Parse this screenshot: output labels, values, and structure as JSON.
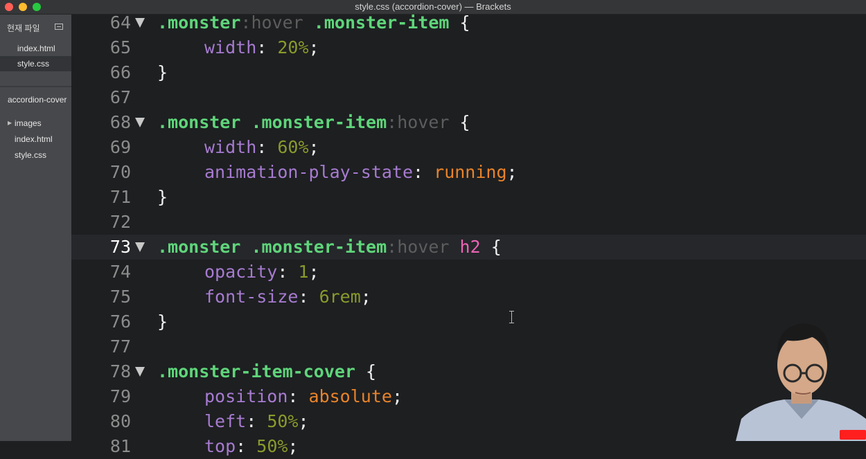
{
  "window": {
    "title": "style.css (accordion-cover) — Brackets"
  },
  "sidebar": {
    "working_files_header": "현재 파일",
    "working_files": [
      {
        "label": "index.html",
        "selected": false
      },
      {
        "label": "style.css",
        "selected": true
      }
    ],
    "project_name": "accordion-cover",
    "tree": [
      {
        "label": "images",
        "type": "folder"
      },
      {
        "label": "index.html",
        "type": "file"
      },
      {
        "label": "style.css",
        "type": "file"
      }
    ]
  },
  "editor": {
    "active_line": "73",
    "lines": [
      {
        "n": "64",
        "fold": true
      },
      {
        "n": "65",
        "fold": false
      },
      {
        "n": "66",
        "fold": false
      },
      {
        "n": "67",
        "fold": false
      },
      {
        "n": "68",
        "fold": true
      },
      {
        "n": "69",
        "fold": false
      },
      {
        "n": "70",
        "fold": false
      },
      {
        "n": "71",
        "fold": false
      },
      {
        "n": "72",
        "fold": false
      },
      {
        "n": "73",
        "fold": true
      },
      {
        "n": "74",
        "fold": false
      },
      {
        "n": "75",
        "fold": false
      },
      {
        "n": "76",
        "fold": false
      },
      {
        "n": "77",
        "fold": false
      },
      {
        "n": "78",
        "fold": true
      },
      {
        "n": "79",
        "fold": false
      },
      {
        "n": "80",
        "fold": false
      },
      {
        "n": "81",
        "fold": false
      }
    ],
    "code": [
      [
        {
          "t": ".monster",
          "c": "sel"
        },
        {
          "t": ":hover",
          "c": "pseudo"
        },
        {
          "t": " ",
          "c": "punc"
        },
        {
          "t": ".monster-item",
          "c": "sel"
        },
        {
          "t": " {",
          "c": "punc"
        }
      ],
      [
        {
          "t": "    ",
          "c": "indent"
        },
        {
          "t": "width",
          "c": "prop"
        },
        {
          "t": ": ",
          "c": "punc"
        },
        {
          "t": "20%",
          "c": "num"
        },
        {
          "t": ";",
          "c": "punc"
        }
      ],
      [
        {
          "t": "}",
          "c": "punc"
        }
      ],
      [],
      [
        {
          "t": ".monster",
          "c": "sel"
        },
        {
          "t": " ",
          "c": "punc"
        },
        {
          "t": ".monster-item",
          "c": "sel"
        },
        {
          "t": ":hover",
          "c": "pseudo"
        },
        {
          "t": " {",
          "c": "punc"
        }
      ],
      [
        {
          "t": "    ",
          "c": "indent"
        },
        {
          "t": "width",
          "c": "prop"
        },
        {
          "t": ": ",
          "c": "punc"
        },
        {
          "t": "60%",
          "c": "num"
        },
        {
          "t": ";",
          "c": "punc"
        }
      ],
      [
        {
          "t": "    ",
          "c": "indent"
        },
        {
          "t": "animation-play-state",
          "c": "prop"
        },
        {
          "t": ": ",
          "c": "punc"
        },
        {
          "t": "running",
          "c": "kw"
        },
        {
          "t": ";",
          "c": "punc"
        }
      ],
      [
        {
          "t": "}",
          "c": "punc"
        }
      ],
      [],
      [
        {
          "t": ".monster",
          "c": "sel"
        },
        {
          "t": " ",
          "c": "punc"
        },
        {
          "t": ".monster-item",
          "c": "sel"
        },
        {
          "t": ":hover",
          "c": "pseudo"
        },
        {
          "t": " ",
          "c": "punc"
        },
        {
          "t": "h2",
          "c": "tag"
        },
        {
          "t": " {",
          "c": "punc"
        }
      ],
      [
        {
          "t": "    ",
          "c": "indent"
        },
        {
          "t": "opacity",
          "c": "prop"
        },
        {
          "t": ": ",
          "c": "punc"
        },
        {
          "t": "1",
          "c": "num"
        },
        {
          "t": ";",
          "c": "punc"
        }
      ],
      [
        {
          "t": "    ",
          "c": "indent"
        },
        {
          "t": "font-size",
          "c": "prop"
        },
        {
          "t": ": ",
          "c": "punc"
        },
        {
          "t": "6rem",
          "c": "num"
        },
        {
          "t": ";",
          "c": "punc"
        }
      ],
      [
        {
          "t": "}",
          "c": "punc"
        }
      ],
      [],
      [
        {
          "t": ".monster-item-cover",
          "c": "sel"
        },
        {
          "t": " {",
          "c": "punc"
        }
      ],
      [
        {
          "t": "    ",
          "c": "indent"
        },
        {
          "t": "position",
          "c": "prop"
        },
        {
          "t": ": ",
          "c": "punc"
        },
        {
          "t": "absolute",
          "c": "kw"
        },
        {
          "t": ";",
          "c": "punc"
        }
      ],
      [
        {
          "t": "    ",
          "c": "indent"
        },
        {
          "t": "left",
          "c": "prop"
        },
        {
          "t": ": ",
          "c": "punc"
        },
        {
          "t": "50%",
          "c": "num"
        },
        {
          "t": ";",
          "c": "punc"
        }
      ],
      [
        {
          "t": "    ",
          "c": "indent"
        },
        {
          "t": "top",
          "c": "prop"
        },
        {
          "t": ": ",
          "c": "punc"
        },
        {
          "t": "50%",
          "c": "num"
        },
        {
          "t": ";",
          "c": "punc"
        }
      ]
    ]
  },
  "overlay": {
    "webcam": "presenter-webcam",
    "badge_color": "#ff1f1f"
  },
  "colors": {
    "background": "#1d1f21",
    "sidebar": "#47484b",
    "selector": "#5fd57a",
    "property": "#a77bd0",
    "number": "#8a9a2b",
    "keyword": "#e9832a",
    "tag": "#ee64b4",
    "pseudo": "#5d5d5d"
  }
}
